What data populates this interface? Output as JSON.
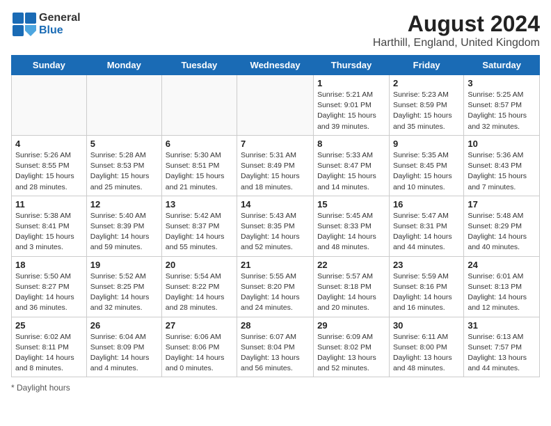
{
  "header": {
    "logo_line1": "General",
    "logo_line2": "Blue",
    "main_title": "August 2024",
    "subtitle": "Harthill, England, United Kingdom"
  },
  "days_of_week": [
    "Sunday",
    "Monday",
    "Tuesday",
    "Wednesday",
    "Thursday",
    "Friday",
    "Saturday"
  ],
  "weeks": [
    [
      {
        "date": "",
        "info": ""
      },
      {
        "date": "",
        "info": ""
      },
      {
        "date": "",
        "info": ""
      },
      {
        "date": "",
        "info": ""
      },
      {
        "date": "1",
        "info": "Sunrise: 5:21 AM\nSunset: 9:01 PM\nDaylight: 15 hours and 39 minutes."
      },
      {
        "date": "2",
        "info": "Sunrise: 5:23 AM\nSunset: 8:59 PM\nDaylight: 15 hours and 35 minutes."
      },
      {
        "date": "3",
        "info": "Sunrise: 5:25 AM\nSunset: 8:57 PM\nDaylight: 15 hours and 32 minutes."
      }
    ],
    [
      {
        "date": "4",
        "info": "Sunrise: 5:26 AM\nSunset: 8:55 PM\nDaylight: 15 hours and 28 minutes."
      },
      {
        "date": "5",
        "info": "Sunrise: 5:28 AM\nSunset: 8:53 PM\nDaylight: 15 hours and 25 minutes."
      },
      {
        "date": "6",
        "info": "Sunrise: 5:30 AM\nSunset: 8:51 PM\nDaylight: 15 hours and 21 minutes."
      },
      {
        "date": "7",
        "info": "Sunrise: 5:31 AM\nSunset: 8:49 PM\nDaylight: 15 hours and 18 minutes."
      },
      {
        "date": "8",
        "info": "Sunrise: 5:33 AM\nSunset: 8:47 PM\nDaylight: 15 hours and 14 minutes."
      },
      {
        "date": "9",
        "info": "Sunrise: 5:35 AM\nSunset: 8:45 PM\nDaylight: 15 hours and 10 minutes."
      },
      {
        "date": "10",
        "info": "Sunrise: 5:36 AM\nSunset: 8:43 PM\nDaylight: 15 hours and 7 minutes."
      }
    ],
    [
      {
        "date": "11",
        "info": "Sunrise: 5:38 AM\nSunset: 8:41 PM\nDaylight: 15 hours and 3 minutes."
      },
      {
        "date": "12",
        "info": "Sunrise: 5:40 AM\nSunset: 8:39 PM\nDaylight: 14 hours and 59 minutes."
      },
      {
        "date": "13",
        "info": "Sunrise: 5:42 AM\nSunset: 8:37 PM\nDaylight: 14 hours and 55 minutes."
      },
      {
        "date": "14",
        "info": "Sunrise: 5:43 AM\nSunset: 8:35 PM\nDaylight: 14 hours and 52 minutes."
      },
      {
        "date": "15",
        "info": "Sunrise: 5:45 AM\nSunset: 8:33 PM\nDaylight: 14 hours and 48 minutes."
      },
      {
        "date": "16",
        "info": "Sunrise: 5:47 AM\nSunset: 8:31 PM\nDaylight: 14 hours and 44 minutes."
      },
      {
        "date": "17",
        "info": "Sunrise: 5:48 AM\nSunset: 8:29 PM\nDaylight: 14 hours and 40 minutes."
      }
    ],
    [
      {
        "date": "18",
        "info": "Sunrise: 5:50 AM\nSunset: 8:27 PM\nDaylight: 14 hours and 36 minutes."
      },
      {
        "date": "19",
        "info": "Sunrise: 5:52 AM\nSunset: 8:25 PM\nDaylight: 14 hours and 32 minutes."
      },
      {
        "date": "20",
        "info": "Sunrise: 5:54 AM\nSunset: 8:22 PM\nDaylight: 14 hours and 28 minutes."
      },
      {
        "date": "21",
        "info": "Sunrise: 5:55 AM\nSunset: 8:20 PM\nDaylight: 14 hours and 24 minutes."
      },
      {
        "date": "22",
        "info": "Sunrise: 5:57 AM\nSunset: 8:18 PM\nDaylight: 14 hours and 20 minutes."
      },
      {
        "date": "23",
        "info": "Sunrise: 5:59 AM\nSunset: 8:16 PM\nDaylight: 14 hours and 16 minutes."
      },
      {
        "date": "24",
        "info": "Sunrise: 6:01 AM\nSunset: 8:13 PM\nDaylight: 14 hours and 12 minutes."
      }
    ],
    [
      {
        "date": "25",
        "info": "Sunrise: 6:02 AM\nSunset: 8:11 PM\nDaylight: 14 hours and 8 minutes."
      },
      {
        "date": "26",
        "info": "Sunrise: 6:04 AM\nSunset: 8:09 PM\nDaylight: 14 hours and 4 minutes."
      },
      {
        "date": "27",
        "info": "Sunrise: 6:06 AM\nSunset: 8:06 PM\nDaylight: 14 hours and 0 minutes."
      },
      {
        "date": "28",
        "info": "Sunrise: 6:07 AM\nSunset: 8:04 PM\nDaylight: 13 hours and 56 minutes."
      },
      {
        "date": "29",
        "info": "Sunrise: 6:09 AM\nSunset: 8:02 PM\nDaylight: 13 hours and 52 minutes."
      },
      {
        "date": "30",
        "info": "Sunrise: 6:11 AM\nSunset: 8:00 PM\nDaylight: 13 hours and 48 minutes."
      },
      {
        "date": "31",
        "info": "Sunrise: 6:13 AM\nSunset: 7:57 PM\nDaylight: 13 hours and 44 minutes."
      }
    ]
  ],
  "footer": {
    "note": "Daylight hours"
  }
}
